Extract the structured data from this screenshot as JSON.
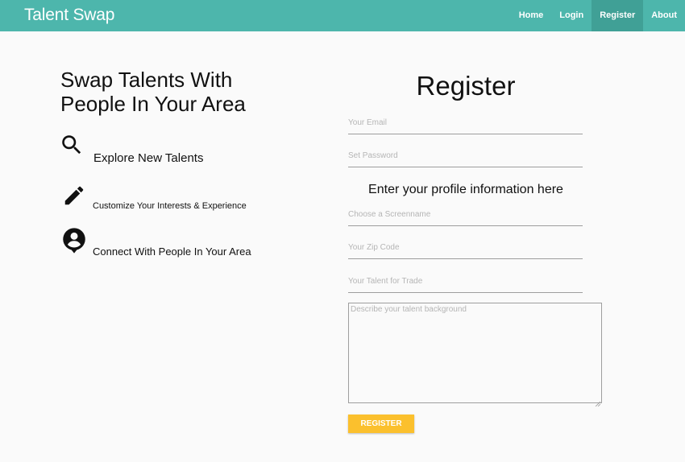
{
  "navbar": {
    "brand": "Talent Swap",
    "links": [
      "Home",
      "Login",
      "Register",
      "About"
    ],
    "active_link": "Register",
    "color": "#4db6ac"
  },
  "left": {
    "headline_line1": "Swap Talents With",
    "headline_line2": "People In Your Area",
    "features": [
      {
        "icon": "search-icon",
        "text": "Explore New Talents"
      },
      {
        "icon": "pencil-icon",
        "text": "Customize Your Interests & Experience"
      },
      {
        "icon": "account-location-icon",
        "text": "Connect With People In Your Area"
      }
    ]
  },
  "form": {
    "title": "Register",
    "email_placeholder": "Your Email",
    "password_placeholder": "Set Password",
    "profile_heading": "Enter your profile information here",
    "screenname_placeholder": "Choose a Screenname",
    "zip_placeholder": "Your Zip Code",
    "talent_placeholder": "Your Talent for Trade",
    "background_placeholder": "Describe your talent background",
    "submit_label": "REGISTER",
    "button_color": "#fbc02d"
  }
}
